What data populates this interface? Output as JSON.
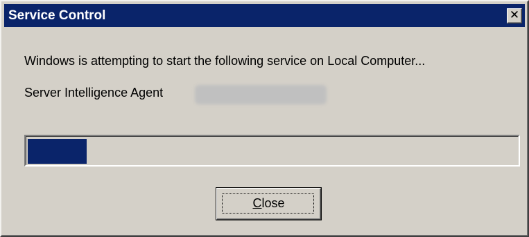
{
  "window": {
    "title": "Service Control",
    "close_glyph": "✕"
  },
  "content": {
    "message": "Windows is attempting to start the following service on Local Computer...",
    "service_name": "Server Intelligence Agent"
  },
  "progress": {
    "fraction": 0.12
  },
  "buttons": {
    "close_label_mnemonic": "C",
    "close_label_rest": "lose"
  },
  "colors": {
    "titlebar": "#0a246a",
    "face": "#d4d0c8",
    "progress_fill": "#0a246a"
  }
}
